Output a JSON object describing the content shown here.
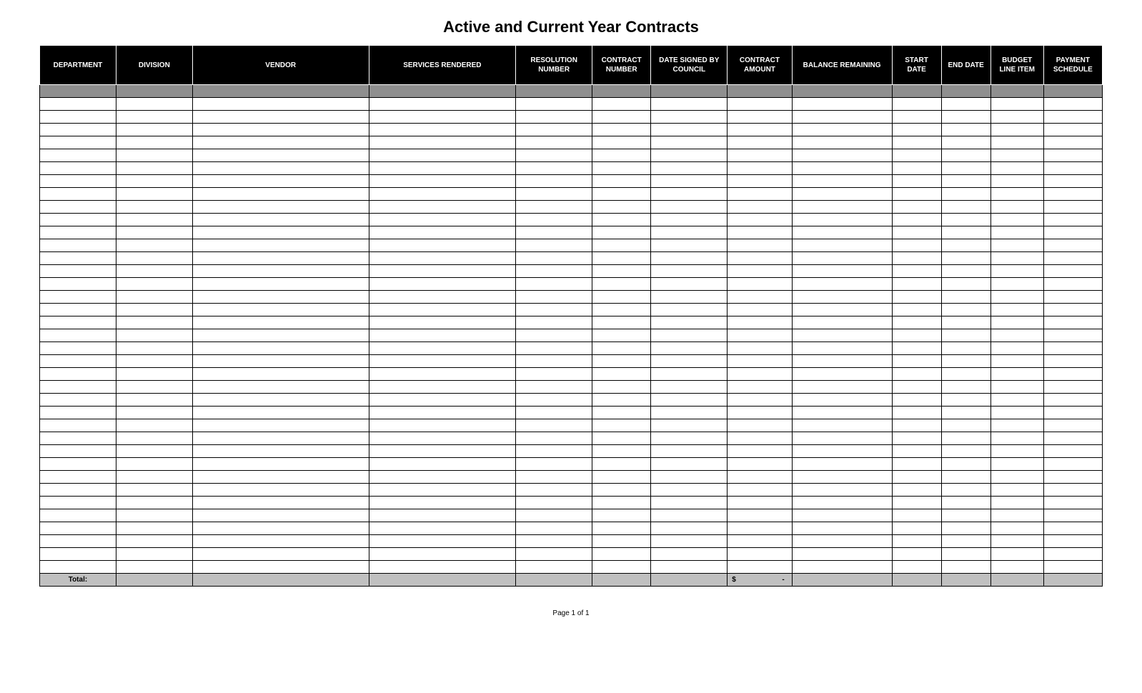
{
  "title": "Active and Current Year Contracts",
  "columns": [
    "DEPARTMENT",
    "DIVISION",
    "VENDOR",
    "SERVICES RENDERED",
    "RESOLUTION NUMBER",
    "CONTRACT NUMBER",
    "DATE SIGNED BY COUNCIL",
    "CONTRACT AMOUNT",
    "BALANCE REMAINING",
    "START DATE",
    "END DATE",
    "BUDGET LINE ITEM",
    "PAYMENT SCHEDULE"
  ],
  "shaded_row_count": 1,
  "blank_row_count": 37,
  "total": {
    "label": "Total:",
    "currency": "$",
    "value": "-"
  },
  "footer": "Page 1 of 1"
}
